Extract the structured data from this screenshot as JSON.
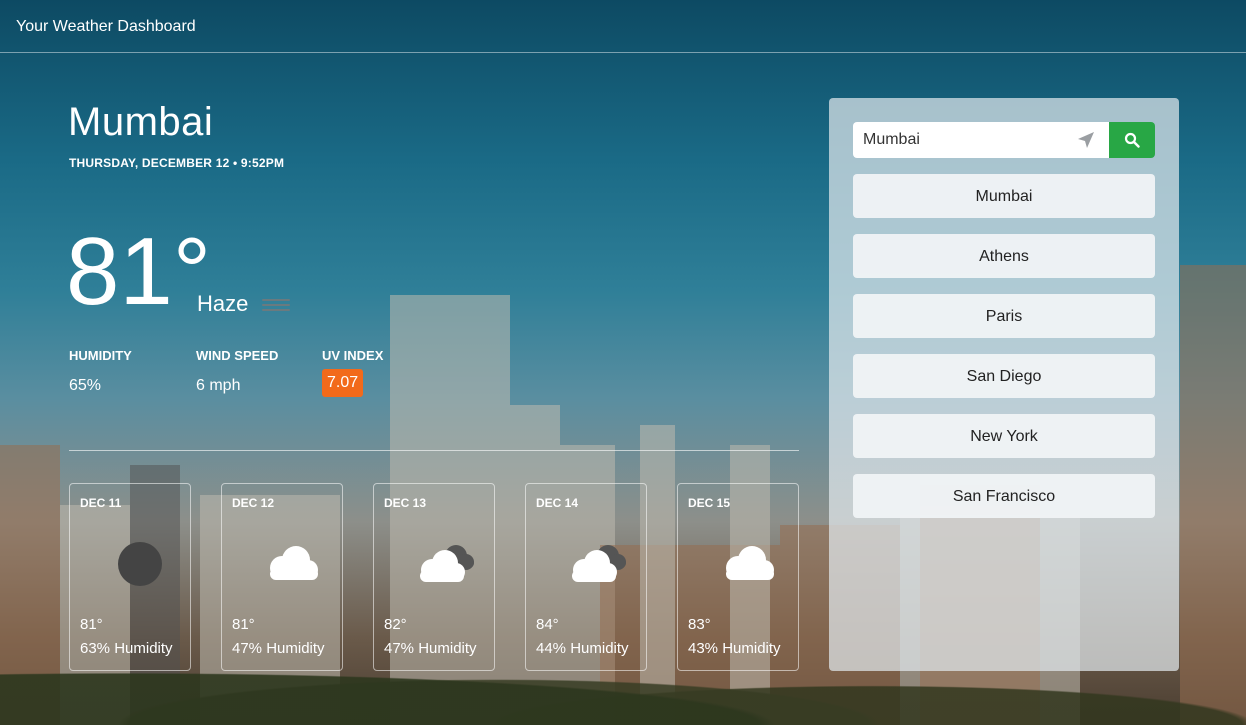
{
  "app": {
    "title": "Your Weather Dashboard"
  },
  "current": {
    "city": "Mumbai",
    "datetime": "THURSDAY, DECEMBER 12 • 9:52PM",
    "temperature": "81°",
    "condition": "Haze",
    "condition_icon": "haze-icon",
    "humidity_label": "HUMIDITY",
    "humidity_value": "65%",
    "wind_label": "WIND SPEED",
    "wind_value": "6 mph",
    "uv_label": "UV INDEX",
    "uv_value": "7.07",
    "uv_color": "#f26a1b"
  },
  "forecast": [
    {
      "date": "DEC 11",
      "icon": "moon-icon",
      "temp": "81°",
      "humidity": "63% Humidity"
    },
    {
      "date": "DEC 12",
      "icon": "cloud-icon",
      "temp": "81°",
      "humidity": "47% Humidity"
    },
    {
      "date": "DEC 13",
      "icon": "clouds-icon",
      "temp": "82°",
      "humidity": "47% Humidity"
    },
    {
      "date": "DEC 14",
      "icon": "clouds-icon",
      "temp": "84°",
      "humidity": "44% Humidity"
    },
    {
      "date": "DEC 15",
      "icon": "cloud-icon",
      "temp": "83°",
      "humidity": "43% Humidity"
    }
  ],
  "search": {
    "value": "Mumbai",
    "button_color": "#28a745"
  },
  "history": [
    "Mumbai",
    "Athens",
    "Paris",
    "San Diego",
    "New York",
    "San Francisco"
  ]
}
